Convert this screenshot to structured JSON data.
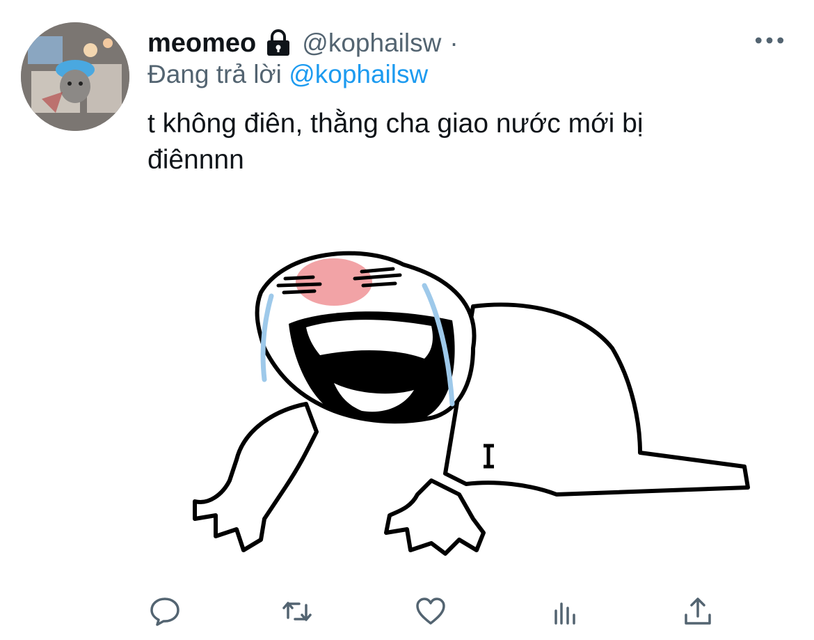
{
  "tweet": {
    "author": {
      "display_name": "meomeo",
      "handle": "@kophailsw",
      "separator": "·",
      "protected_icon": "lock-icon",
      "avatar": "avatar"
    },
    "reply_prefix": "Đang trả lời",
    "reply_to": "@kophailsw",
    "text_line1": "t không điên, thằng cha giao nước mới bị",
    "text_line2": "điênnnn",
    "media": "crying-meme-image",
    "more_icon": "more-icon"
  },
  "actions": [
    {
      "name": "reply",
      "icon": "comment-icon"
    },
    {
      "name": "retweet",
      "icon": "retweet-icon"
    },
    {
      "name": "like",
      "icon": "heart-icon"
    },
    {
      "name": "analytics",
      "icon": "analytics-icon"
    },
    {
      "name": "share",
      "icon": "share-icon"
    }
  ],
  "colors": {
    "text": "#0f1419",
    "secondary": "#536471",
    "link": "#1d9bf0"
  }
}
